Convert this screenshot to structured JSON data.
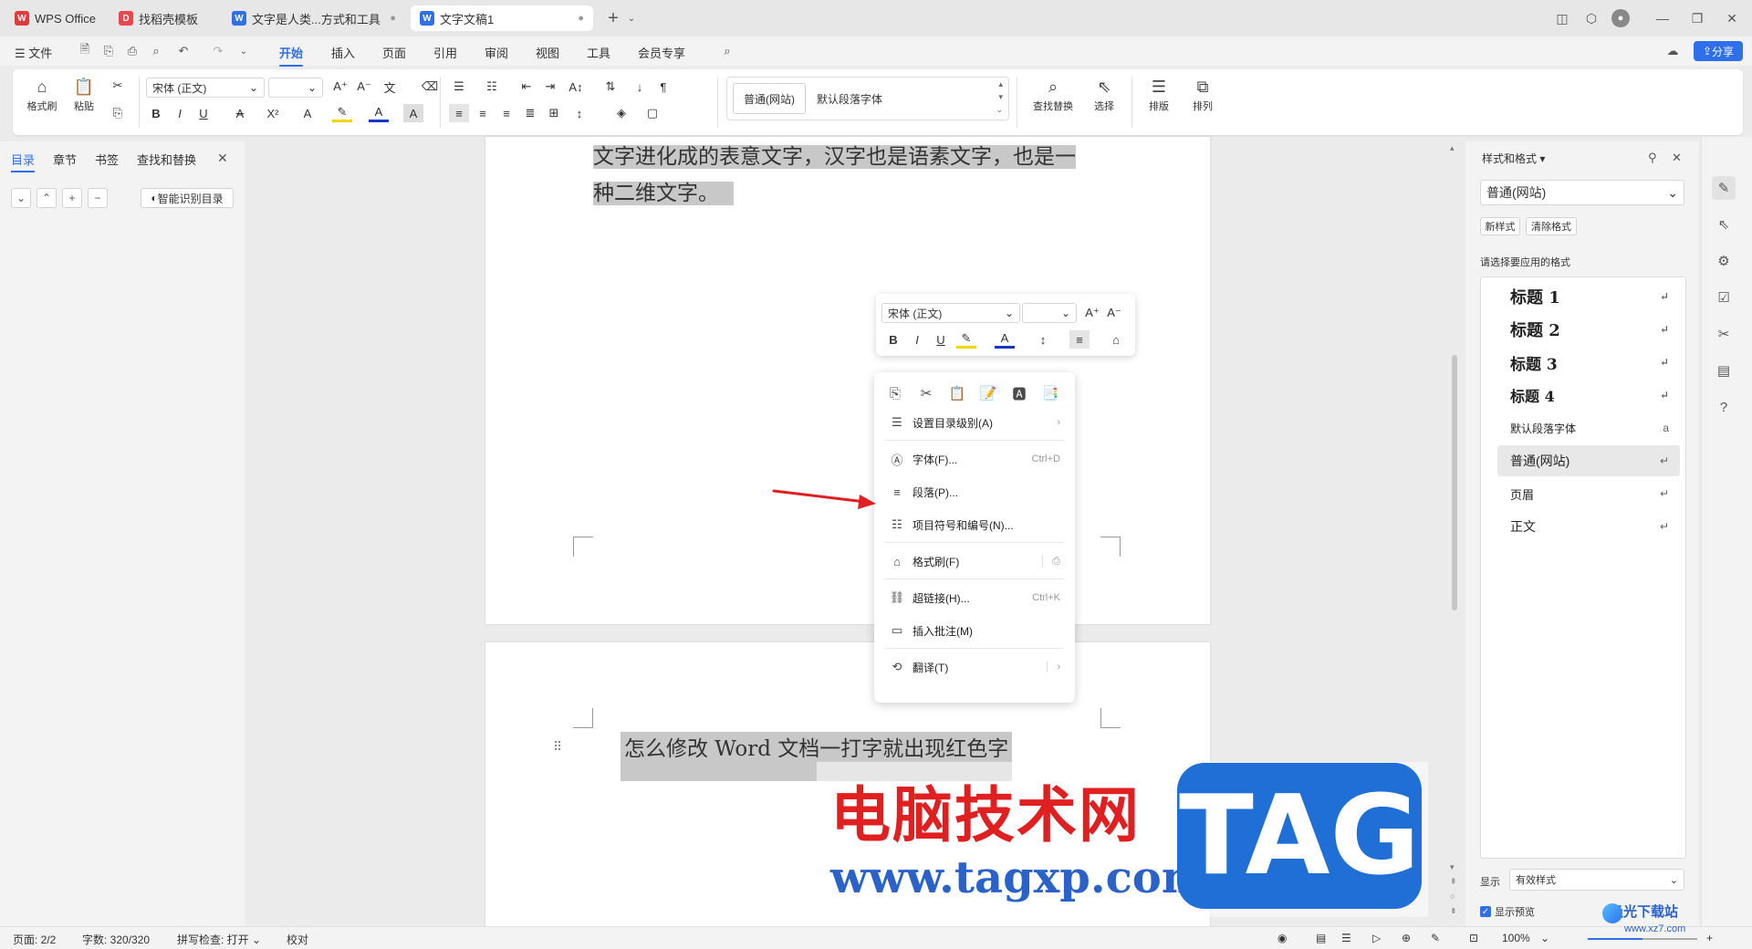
{
  "tabs": [
    {
      "label": "WPS Office",
      "icon": "wps-logo-icon",
      "color": "#e03a3a"
    },
    {
      "label": "找稻壳模板",
      "icon": "docer-icon",
      "color": "#e8484e"
    },
    {
      "label": "文字是人类...方式和工具",
      "icon": "word-doc-icon",
      "color": "#2f6feb"
    },
    {
      "label": "文字文稿1",
      "icon": "word-doc-icon",
      "color": "#2f6feb"
    }
  ],
  "menu": {
    "file": "文件",
    "items": [
      "开始",
      "插入",
      "页面",
      "引用",
      "审阅",
      "视图",
      "工具",
      "会员专享"
    ],
    "active_index": 0,
    "share": "分享"
  },
  "ribbon": {
    "format_painter": "格式刷",
    "paste": "粘贴",
    "font_name": "宋体 (正文)",
    "font_size": "",
    "style_normal_web": "普通(网站)",
    "style_default_para": "默认段落字体",
    "find_replace": "查找替换",
    "select": "选择",
    "layout": "排版",
    "arrange": "排列",
    "bold": "B",
    "italic": "I",
    "underline": "U",
    "strike": "A",
    "superscript": "X²"
  },
  "left_panel": {
    "tabs": [
      "目录",
      "章节",
      "书签",
      "查找和替换"
    ],
    "active_index": 0,
    "smart_toc": "智能识别目录"
  },
  "document": {
    "para1_line1": "文字进化成的表意文字，汉字也是语素文字，也是一",
    "para1_line2": "种二维文字。",
    "page2_line": "怎么修改 Word 文档一打字就出现红色字"
  },
  "mini_toolbar": {
    "font_name": "宋体 (正文)",
    "font_size": ""
  },
  "context_menu": {
    "items": [
      {
        "label": "设置目录级别(A)",
        "icon": "toc-level-icon",
        "shortcut": "",
        "submenu": true
      },
      {
        "label": "字体(F)...",
        "icon": "font-icon",
        "shortcut": "Ctrl+D",
        "submenu": false
      },
      {
        "label": "段落(P)...",
        "icon": "paragraph-icon",
        "shortcut": "",
        "submenu": false
      },
      {
        "label": "项目符号和编号(N)...",
        "icon": "bullet-list-icon",
        "shortcut": "",
        "submenu": false
      },
      {
        "label": "格式刷(F)",
        "icon": "format-painter-icon",
        "shortcut": "",
        "submenu": false
      },
      {
        "label": "超链接(H)...",
        "icon": "hyperlink-icon",
        "shortcut": "Ctrl+K",
        "submenu": false
      },
      {
        "label": "插入批注(M)",
        "icon": "comment-icon",
        "shortcut": "",
        "submenu": false
      },
      {
        "label": "翻译(T)",
        "icon": "translate-icon",
        "shortcut": "",
        "submenu": true
      }
    ]
  },
  "style_panel": {
    "title": "样式和格式",
    "current_style": "普通(网站)",
    "new_style": "新样式",
    "clear_format": "清除格式",
    "apply_hint": "请选择要应用的格式",
    "styles": [
      {
        "label": "标题  1",
        "kind": "heading"
      },
      {
        "label": "标题  2",
        "kind": "heading"
      },
      {
        "label": "标题  3",
        "kind": "heading"
      },
      {
        "label": "标题 4",
        "kind": "heading"
      },
      {
        "label": "默认段落字体",
        "kind": "char"
      },
      {
        "label": "普通(网站)",
        "kind": "selected"
      },
      {
        "label": "页眉",
        "kind": "normal"
      },
      {
        "label": "正文",
        "kind": "normal"
      }
    ],
    "show_label": "显示",
    "show_value": "有效样式",
    "preview_label": "显示预览"
  },
  "status": {
    "page": "页面: 2/2",
    "word_count": "字数: 320/320",
    "spell_check": "拼写检查: 打开",
    "proofread": "校对",
    "zoom": "100%"
  },
  "watermark": {
    "cn": "电脑技术网",
    "url": "www.tagxp.com",
    "tag": "TAG",
    "corner": "极光下载站",
    "corner_url": "www.xz7.com"
  },
  "colors": {
    "accent": "#2f6feb",
    "arrow": "#e02020",
    "tag_bg": "#1f6fd6"
  }
}
